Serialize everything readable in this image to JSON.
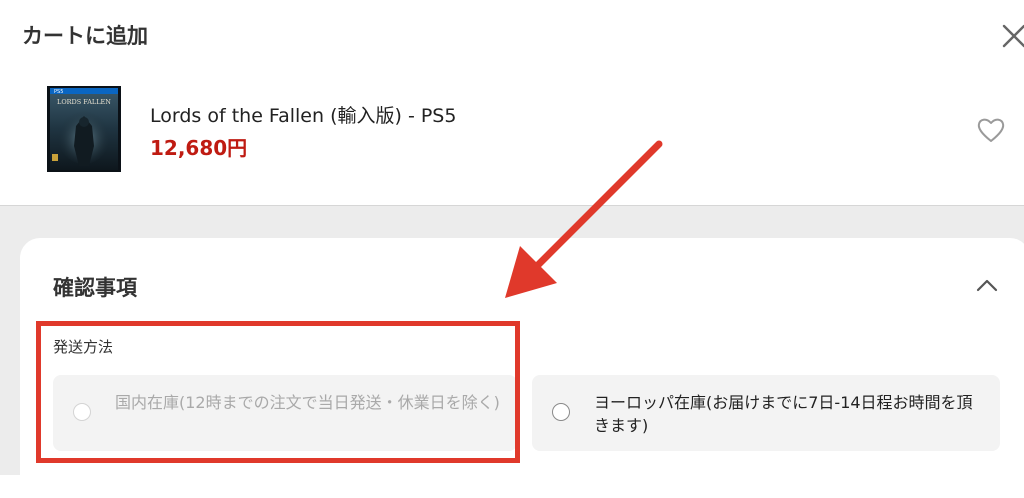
{
  "modal": {
    "title": "カートに追加"
  },
  "product": {
    "name": "Lords of the Fallen (輸入版) - PS5",
    "price": "12,680円",
    "image_icon": "game-cover-image",
    "cover_text": "LORDS FALLEN",
    "cover_platform": "PS5"
  },
  "confirm": {
    "title": "確認事項",
    "shipping_label": "発送方法",
    "options": [
      {
        "label": "国内在庫(12時までの注文で当日発送・休業日を除く)",
        "disabled": true
      },
      {
        "label": "ヨーロッパ在庫(お届けまでに7日-14日程お時間を頂きます)",
        "disabled": false
      }
    ]
  },
  "annotation_color": "#e0392b",
  "price_color": "#bf1b12"
}
